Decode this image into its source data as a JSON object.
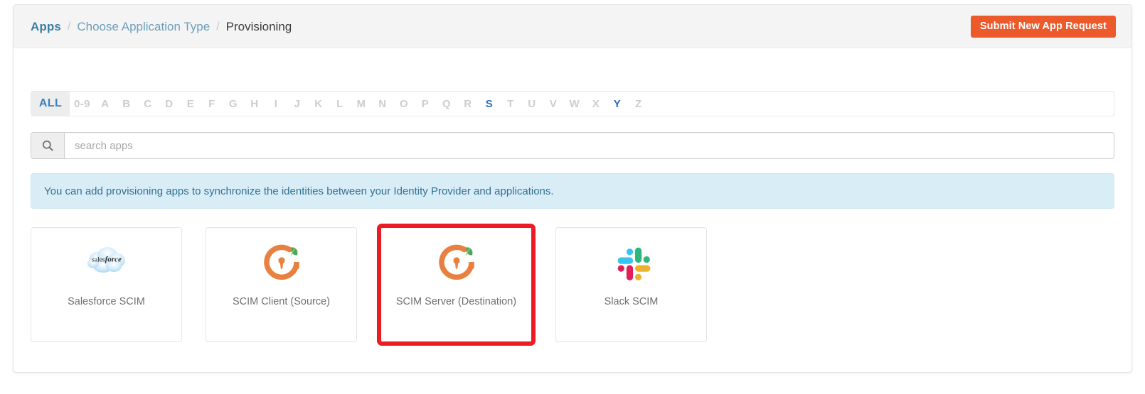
{
  "header": {
    "breadcrumb": [
      {
        "label": "Apps",
        "type": "root"
      },
      {
        "label": "Choose Application Type",
        "type": "link"
      },
      {
        "label": "Provisioning",
        "type": "current"
      }
    ],
    "separator": "/",
    "submit_button": "Submit New App Request",
    "accent_color": "#ec5a2b"
  },
  "filter": {
    "all_label": "ALL",
    "letters": [
      {
        "label": "0-9",
        "active": false
      },
      {
        "label": "A",
        "active": false
      },
      {
        "label": "B",
        "active": false
      },
      {
        "label": "C",
        "active": false
      },
      {
        "label": "D",
        "active": false
      },
      {
        "label": "E",
        "active": false
      },
      {
        "label": "F",
        "active": false
      },
      {
        "label": "G",
        "active": false
      },
      {
        "label": "H",
        "active": false
      },
      {
        "label": "I",
        "active": false
      },
      {
        "label": "J",
        "active": false
      },
      {
        "label": "K",
        "active": false
      },
      {
        "label": "L",
        "active": false
      },
      {
        "label": "M",
        "active": false
      },
      {
        "label": "N",
        "active": false
      },
      {
        "label": "O",
        "active": false
      },
      {
        "label": "P",
        "active": false
      },
      {
        "label": "Q",
        "active": false
      },
      {
        "label": "R",
        "active": false
      },
      {
        "label": "S",
        "active": true
      },
      {
        "label": "T",
        "active": false
      },
      {
        "label": "U",
        "active": false
      },
      {
        "label": "V",
        "active": false
      },
      {
        "label": "W",
        "active": false
      },
      {
        "label": "X",
        "active": false
      },
      {
        "label": "Y",
        "active": true
      },
      {
        "label": "Z",
        "active": false
      }
    ],
    "selected_color": "#2a6fc4"
  },
  "search": {
    "placeholder": "search apps",
    "value": "",
    "icon": "search-icon"
  },
  "info": {
    "message": "You can add provisioning apps to synchronize the identities between your Identity Provider and applications.",
    "background": "#d9edf7",
    "text_color": "#31708f"
  },
  "apps": [
    {
      "label": "Salesforce SCIM",
      "icon": "salesforce-cloud-icon",
      "highlighted": false
    },
    {
      "label": "SCIM Client (Source)",
      "icon": "scim-ring-icon",
      "highlighted": false
    },
    {
      "label": "SCIM Server (Destination)",
      "icon": "scim-ring-icon",
      "highlighted": true
    },
    {
      "label": "Slack SCIM",
      "icon": "slack-icon",
      "highlighted": false
    }
  ],
  "highlight": {
    "color": "#ed1c24"
  }
}
